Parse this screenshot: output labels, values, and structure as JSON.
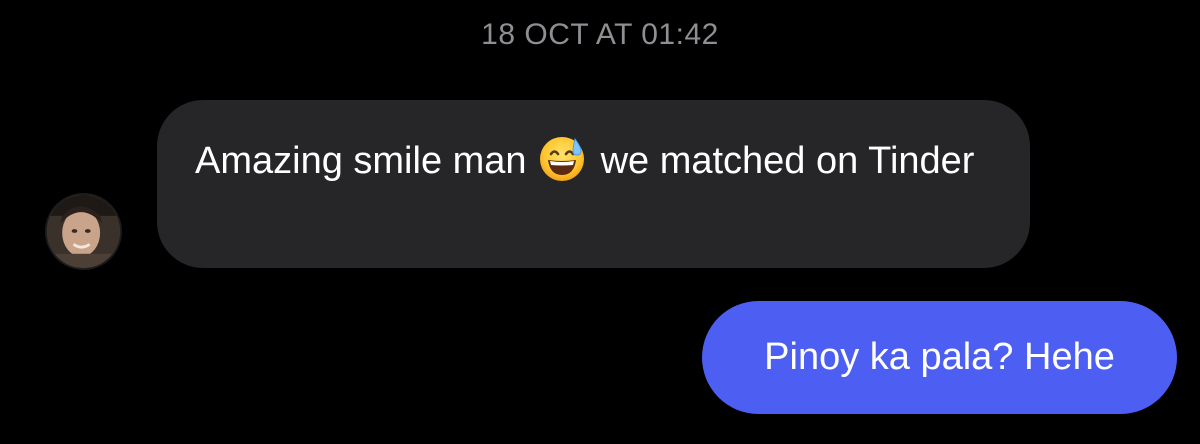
{
  "conversation": {
    "timestamp": "18 OCT AT 01:42",
    "messages": [
      {
        "direction": "incoming",
        "text_before_emoji": "Amazing smile man",
        "emoji": "grinning-face-with-sweat",
        "text_after_emoji": "we matched on Tinder"
      },
      {
        "direction": "outgoing",
        "text": "Pinoy ka pala? Hehe"
      }
    ]
  },
  "colors": {
    "background": "#000000",
    "incoming_bubble": "#262628",
    "outgoing_bubble": "#4c5ff2",
    "timestamp_text": "#8e8e93",
    "message_text": "#ffffff"
  }
}
